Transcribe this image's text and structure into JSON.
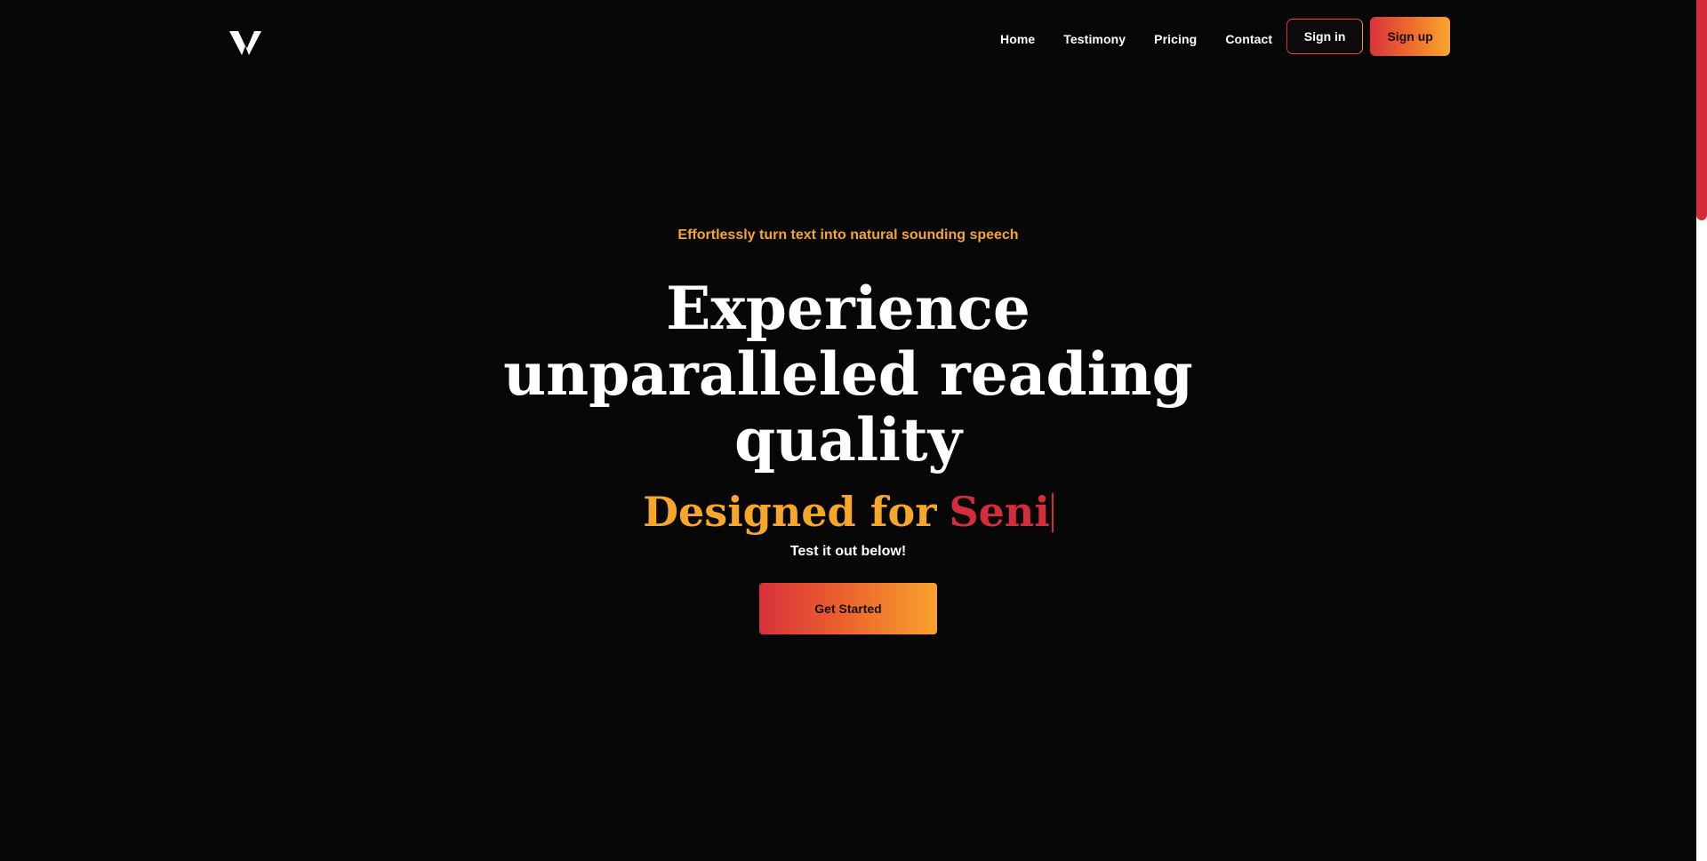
{
  "header": {
    "logo_alt": "V",
    "nav": {
      "home": "Home",
      "testimony": "Testimony",
      "pricing": "Pricing",
      "contact": "Contact"
    },
    "sign_in": "Sign in",
    "sign_up": "Sign up"
  },
  "hero": {
    "tagline": "Effortlessly turn text into natural sounding speech",
    "headline_line1": "Experience",
    "headline_line2": "unparalleled reading",
    "headline_line3": "quality",
    "designed_prefix": "Designed for",
    "designed_word": "Seni",
    "subtext": "Test it out below!",
    "cta": "Get Started"
  },
  "colors": {
    "background": "#080708",
    "accent_orange": "#f6a42b",
    "accent_red": "#d52d3b",
    "text": "#ffffff"
  },
  "icons": {
    "logo": "v-logo-icon"
  }
}
